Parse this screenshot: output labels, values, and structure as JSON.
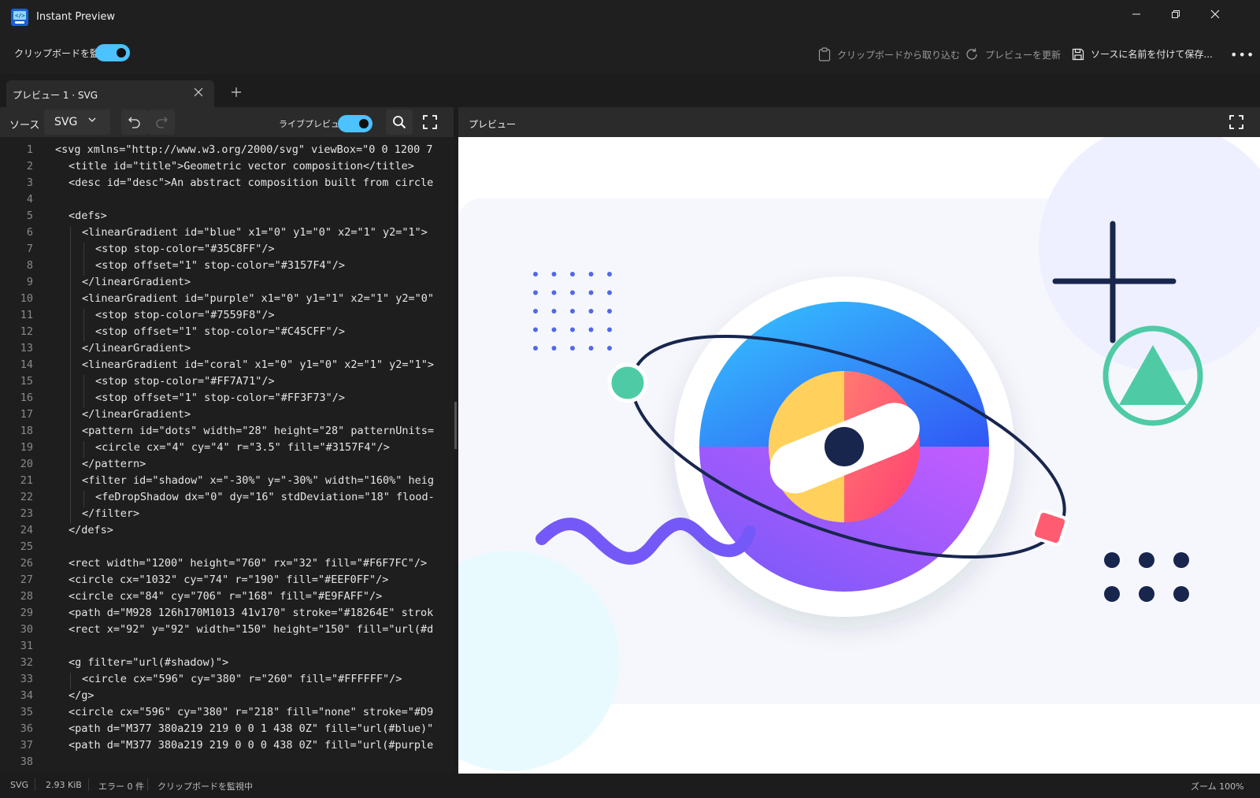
{
  "window": {
    "title": "Instant Preview"
  },
  "command_bar": {
    "watch_clipboard_label": "クリップボードを監視",
    "watch_clipboard_on": true,
    "import_from_clipboard": "クリップボードから取り込む",
    "refresh_preview": "プレビューを更新",
    "save_source_as": "ソースに名前を付けて保存...",
    "more": "•••"
  },
  "tabs": [
    {
      "label": "プレビュー 1 · SVG"
    }
  ],
  "source_toolbar": {
    "label": "ソース",
    "language": "SVG",
    "live_preview_label": "ライブプレビュー",
    "live_preview_on": true
  },
  "preview_toolbar": {
    "label": "プレビュー"
  },
  "editor": {
    "lines": [
      {
        "n": "1",
        "indent": 0,
        "text": "<svg xmlns=\"http://www.w3.org/2000/svg\" viewBox=\"0 0 1200 7"
      },
      {
        "n": "2",
        "indent": 1,
        "text": "<title id=\"title\">Geometric vector composition</title>"
      },
      {
        "n": "3",
        "indent": 1,
        "text": "<desc id=\"desc\">An abstract composition built from circle"
      },
      {
        "n": "4",
        "indent": 0,
        "text": ""
      },
      {
        "n": "5",
        "indent": 1,
        "text": "<defs>"
      },
      {
        "n": "6",
        "indent": 2,
        "text": "<linearGradient id=\"blue\" x1=\"0\" y1=\"0\" x2=\"1\" y2=\"1\">"
      },
      {
        "n": "7",
        "indent": 3,
        "text": "<stop stop-color=\"#35C8FF\"/>"
      },
      {
        "n": "8",
        "indent": 3,
        "text": "<stop offset=\"1\" stop-color=\"#3157F4\"/>"
      },
      {
        "n": "9",
        "indent": 2,
        "text": "</linearGradient>"
      },
      {
        "n": "10",
        "indent": 2,
        "text": "<linearGradient id=\"purple\" x1=\"0\" y1=\"1\" x2=\"1\" y2=\"0\""
      },
      {
        "n": "11",
        "indent": 3,
        "text": "<stop stop-color=\"#7559F8\"/>"
      },
      {
        "n": "12",
        "indent": 3,
        "text": "<stop offset=\"1\" stop-color=\"#C45CFF\"/>"
      },
      {
        "n": "13",
        "indent": 2,
        "text": "</linearGradient>"
      },
      {
        "n": "14",
        "indent": 2,
        "text": "<linearGradient id=\"coral\" x1=\"0\" y1=\"0\" x2=\"1\" y2=\"1\">"
      },
      {
        "n": "15",
        "indent": 3,
        "text": "<stop stop-color=\"#FF7A71\"/>"
      },
      {
        "n": "16",
        "indent": 3,
        "text": "<stop offset=\"1\" stop-color=\"#FF3F73\"/>"
      },
      {
        "n": "17",
        "indent": 2,
        "text": "</linearGradient>"
      },
      {
        "n": "18",
        "indent": 2,
        "text": "<pattern id=\"dots\" width=\"28\" height=\"28\" patternUnits="
      },
      {
        "n": "19",
        "indent": 3,
        "text": "<circle cx=\"4\" cy=\"4\" r=\"3.5\" fill=\"#3157F4\"/>"
      },
      {
        "n": "20",
        "indent": 2,
        "text": "</pattern>"
      },
      {
        "n": "21",
        "indent": 2,
        "text": "<filter id=\"shadow\" x=\"-30%\" y=\"-30%\" width=\"160%\" heig"
      },
      {
        "n": "22",
        "indent": 3,
        "text": "<feDropShadow dx=\"0\" dy=\"16\" stdDeviation=\"18\" flood-"
      },
      {
        "n": "23",
        "indent": 2,
        "text": "</filter>"
      },
      {
        "n": "24",
        "indent": 1,
        "text": "</defs>"
      },
      {
        "n": "25",
        "indent": 0,
        "text": ""
      },
      {
        "n": "26",
        "indent": 1,
        "text": "<rect width=\"1200\" height=\"760\" rx=\"32\" fill=\"#F6F7FC\"/>"
      },
      {
        "n": "27",
        "indent": 1,
        "text": "<circle cx=\"1032\" cy=\"74\" r=\"190\" fill=\"#EEF0FF\"/>"
      },
      {
        "n": "28",
        "indent": 1,
        "text": "<circle cx=\"84\" cy=\"706\" r=\"168\" fill=\"#E9FAFF\"/>"
      },
      {
        "n": "29",
        "indent": 1,
        "text": "<path d=\"M928 126h170M1013 41v170\" stroke=\"#18264E\" strok"
      },
      {
        "n": "30",
        "indent": 1,
        "text": "<rect x=\"92\" y=\"92\" width=\"150\" height=\"150\" fill=\"url(#d"
      },
      {
        "n": "31",
        "indent": 0,
        "text": ""
      },
      {
        "n": "32",
        "indent": 1,
        "text": "<g filter=\"url(#shadow)\">"
      },
      {
        "n": "33",
        "indent": 2,
        "text": "<circle cx=\"596\" cy=\"380\" r=\"260\" fill=\"#FFFFFF\"/>"
      },
      {
        "n": "34",
        "indent": 1,
        "text": "</g>"
      },
      {
        "n": "35",
        "indent": 1,
        "text": "<circle cx=\"596\" cy=\"380\" r=\"218\" fill=\"none\" stroke=\"#D9"
      },
      {
        "n": "36",
        "indent": 1,
        "text": "<path d=\"M377 380a219 219 0 0 1 438 0Z\" fill=\"url(#blue)\""
      },
      {
        "n": "37",
        "indent": 1,
        "text": "<path d=\"M377 380a219 219 0 0 0 438 0Z\" fill=\"url(#purple"
      },
      {
        "n": "38",
        "indent": 0,
        "text": ""
      }
    ]
  },
  "status_bar": {
    "format": "SVG",
    "size": "2.93 KiB",
    "errors": "エラー 0 件",
    "clipboard_state": "クリップボードを監視中",
    "zoom": "ズーム 100%"
  },
  "colors": {
    "accent": "#4cc2ff",
    "canvas_bg": "#F6F7FC",
    "blue_start": "#35C8FF",
    "blue_end": "#3157F4",
    "purple_start": "#7559F8",
    "purple_end": "#C45CFF",
    "coral_start": "#FF7A71",
    "coral_end": "#FF3F73",
    "navy": "#18264E",
    "mint": "#4ECBA5",
    "yellow": "#FFD15C"
  }
}
